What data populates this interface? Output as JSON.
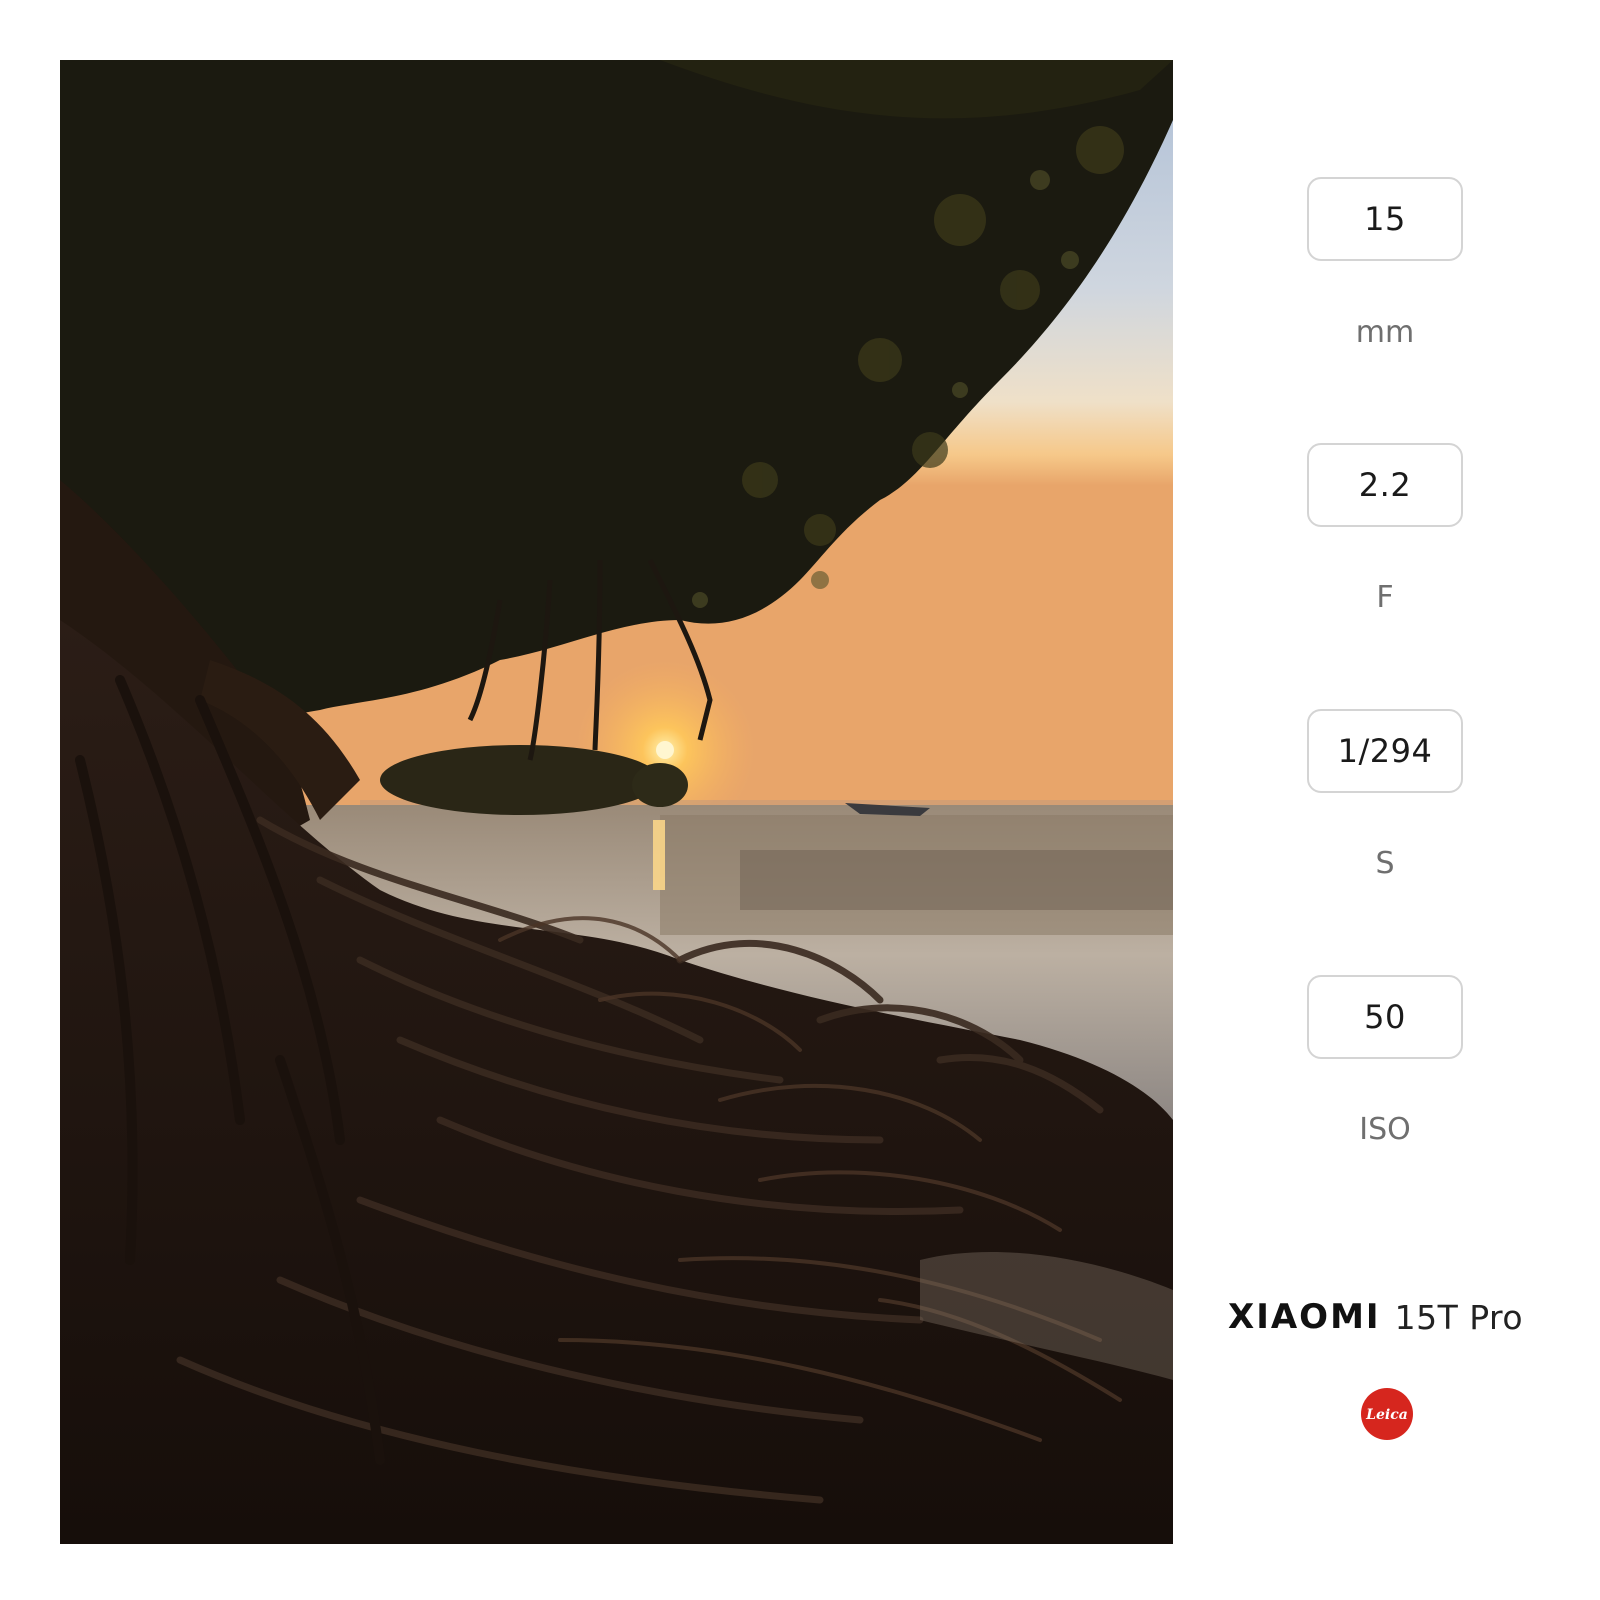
{
  "exif": [
    {
      "value": "15",
      "unit": "mm"
    },
    {
      "value": "2.2",
      "unit": "F"
    },
    {
      "value": "1/294",
      "unit": "S"
    },
    {
      "value": "50",
      "unit": "ISO"
    }
  ],
  "brand": {
    "name": "XIAOMI",
    "model": "15T Pro",
    "logo_text": "Leica",
    "logo_color": "#d6261e"
  },
  "colors": {
    "sky_top": "#b9c6d8",
    "sky_horizon": "#f3c98f",
    "sun": "#ffd36a",
    "foliage": "#1c1a10",
    "roots": "#2a1b14"
  }
}
